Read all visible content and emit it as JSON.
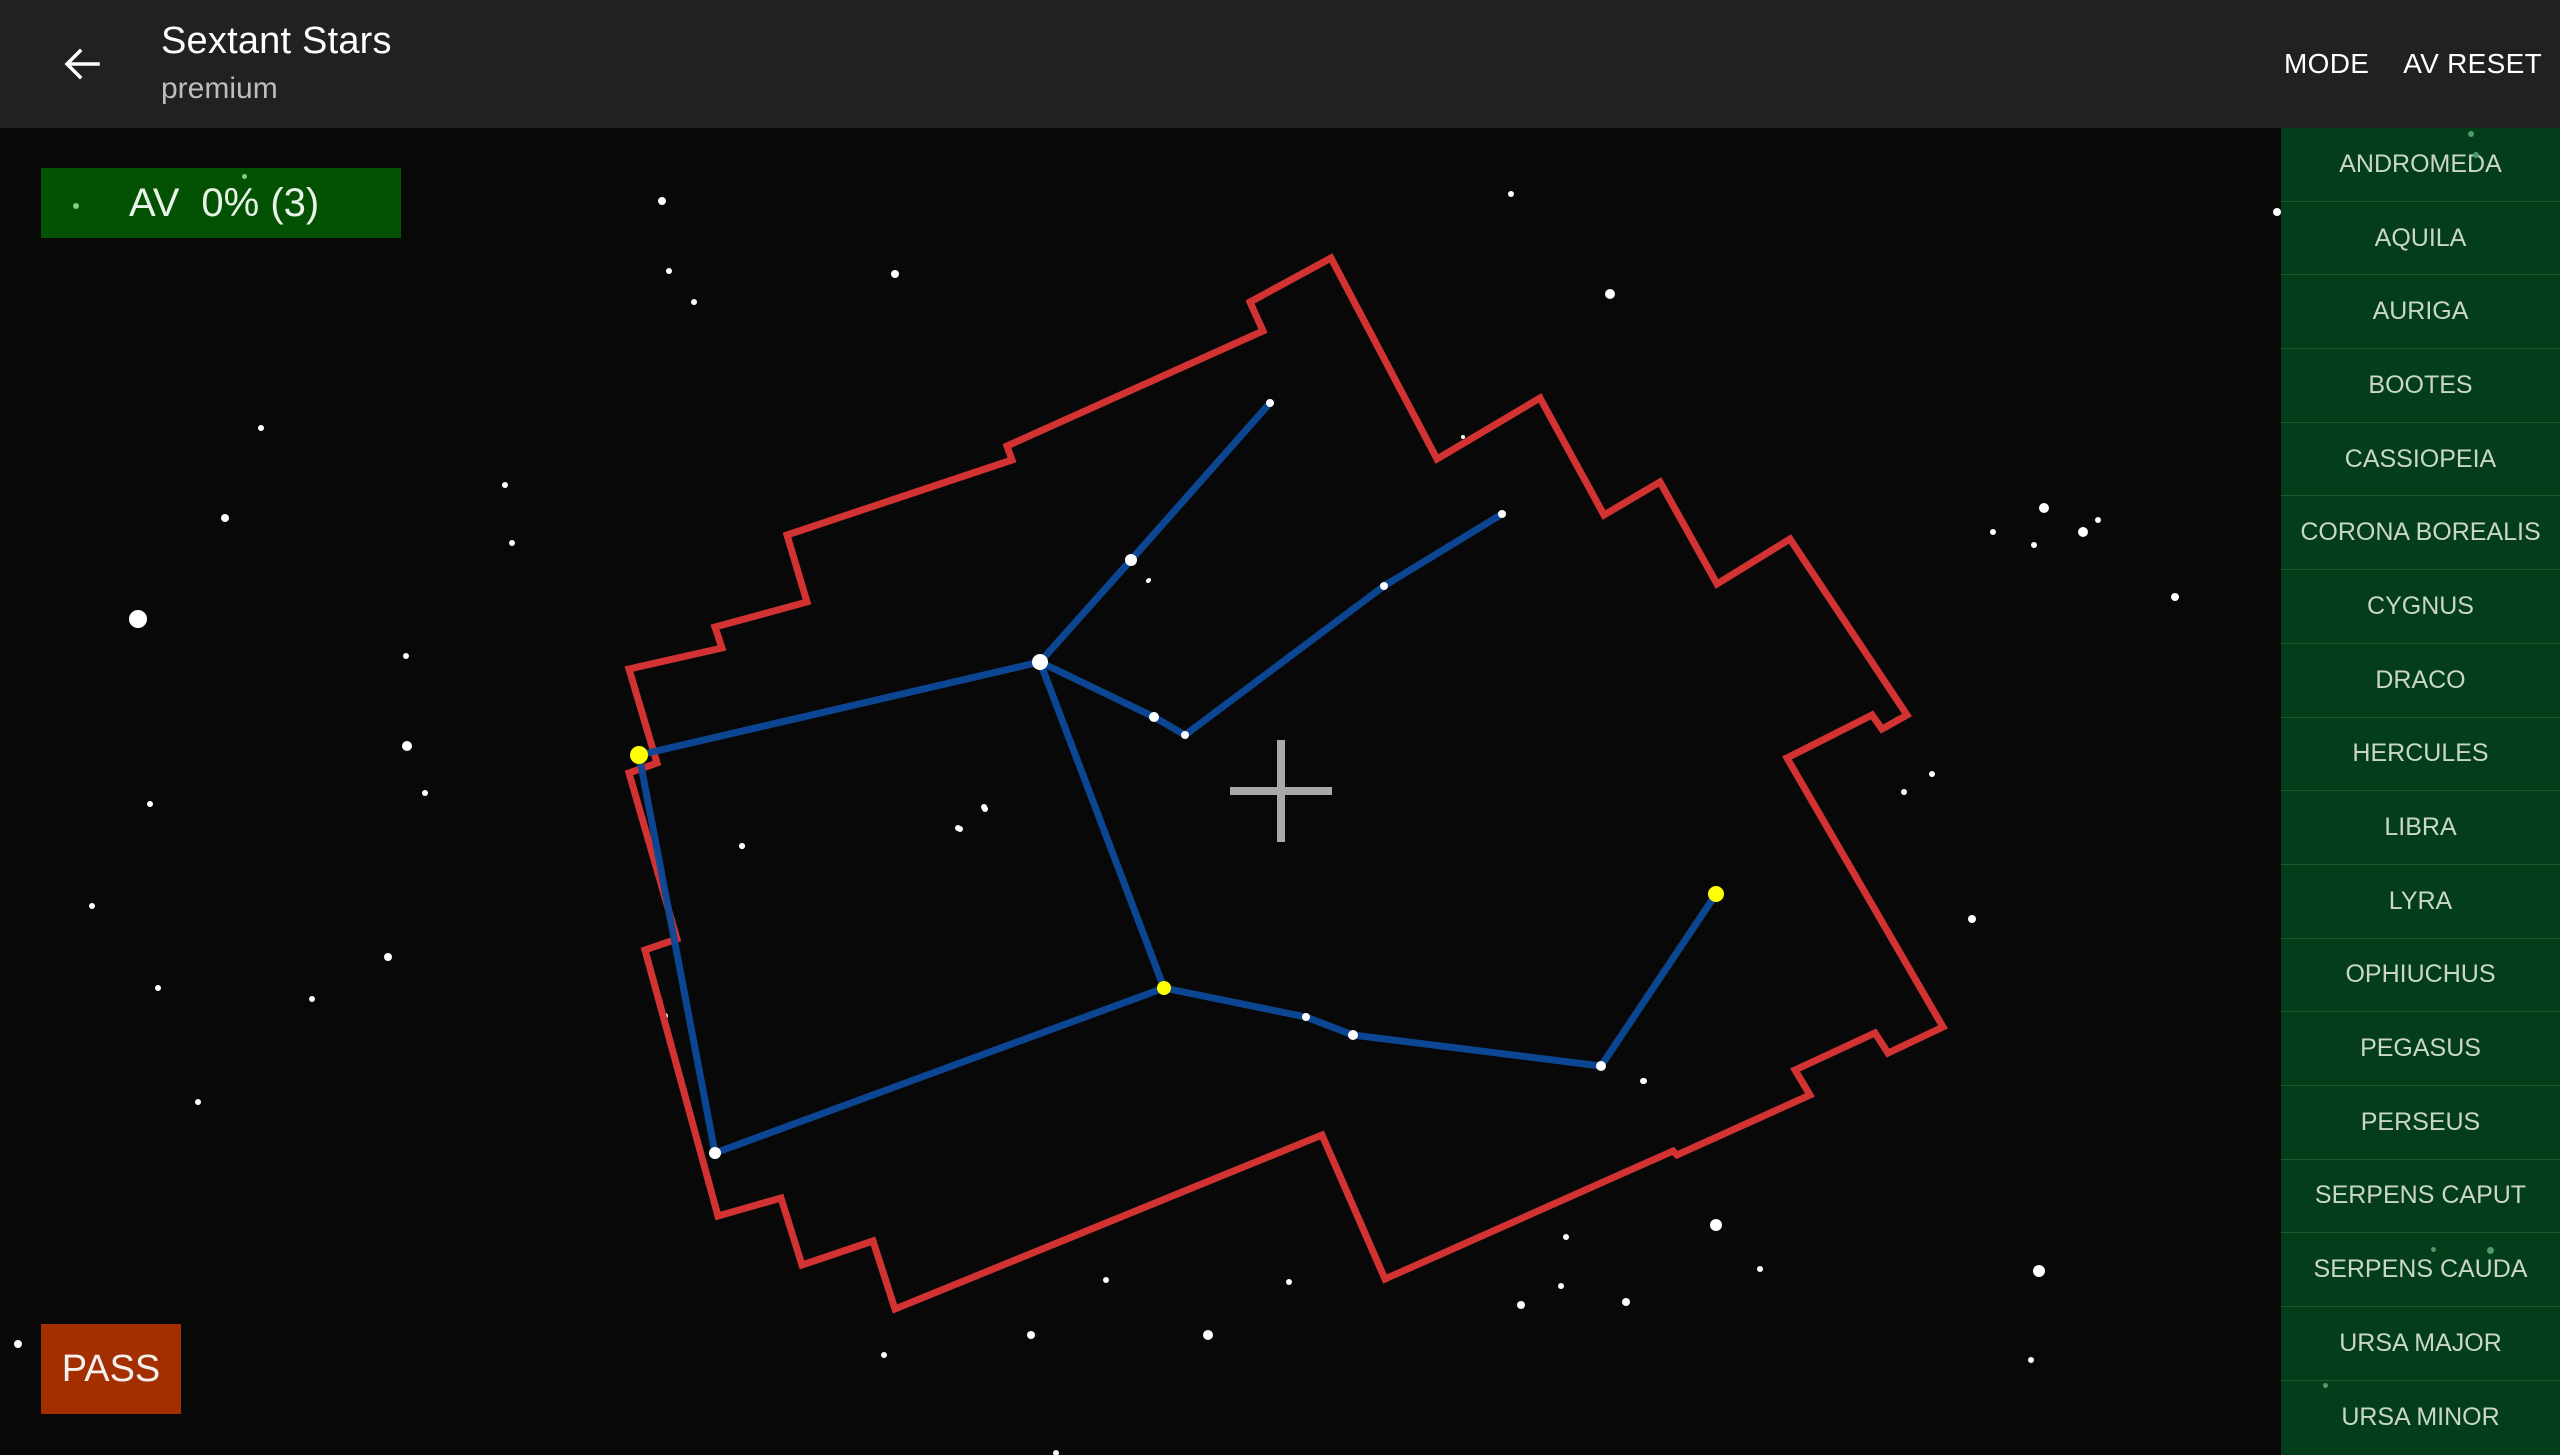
{
  "header": {
    "title": "Sextant Stars",
    "subtitle": "premium",
    "back_icon": "arrow-left-icon",
    "actions": [
      {
        "label": "MODE"
      },
      {
        "label": "AV RESET"
      }
    ]
  },
  "av_status": {
    "label": "AV",
    "value": "0% (3)",
    "bg_color": "#035203"
  },
  "pass_button": {
    "label": "PASS",
    "bg_color": "#a32e00"
  },
  "sidebar": {
    "items": [
      {
        "label": "ANDROMEDA"
      },
      {
        "label": "AQUILA"
      },
      {
        "label": "AURIGA"
      },
      {
        "label": "BOOTES"
      },
      {
        "label": "CASSIOPEIA"
      },
      {
        "label": "CORONA BOREALIS"
      },
      {
        "label": "CYGNUS"
      },
      {
        "label": "DRACO"
      },
      {
        "label": "HERCULES"
      },
      {
        "label": "LIBRA"
      },
      {
        "label": "LYRA"
      },
      {
        "label": "OPHIUCHUS"
      },
      {
        "label": "PEGASUS"
      },
      {
        "label": "PERSEUS"
      },
      {
        "label": "SERPENS CAPUT"
      },
      {
        "label": "SERPENS CAUDA"
      },
      {
        "label": "URSA MAJOR"
      },
      {
        "label": "URSA MINOR"
      }
    ]
  },
  "sky_map": {
    "crosshair_icon": "crosshair-icon",
    "colors": {
      "boundary": "#d23232",
      "figure_lines": "#0d4a9a",
      "highlight_star": "#ffff00",
      "star": "#ffffff",
      "crosshair": "#a8a8a8"
    },
    "highlighted_star_count": 3
  }
}
